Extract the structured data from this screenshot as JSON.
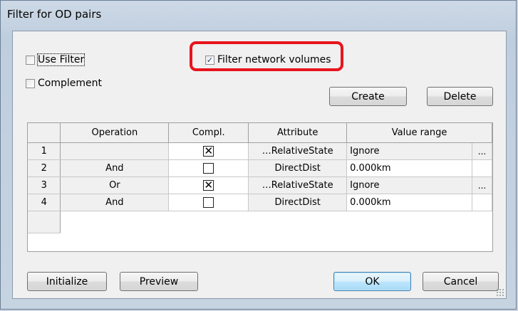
{
  "dialog": {
    "title": "Filter for OD pairs"
  },
  "options": {
    "use_filter": {
      "label": "Use Filter",
      "checked": false
    },
    "complement": {
      "label": "Complement",
      "checked": false
    },
    "filter_network_volumes": {
      "label": "Filter network volumes",
      "checked": true
    }
  },
  "buttons": {
    "create": "Create",
    "delete": "Delete",
    "initialize": "Initialize",
    "preview": "Preview",
    "ok": "OK",
    "cancel": "Cancel"
  },
  "table": {
    "headers": [
      "",
      "Operation",
      "Compl.",
      "Attribute",
      "Value range"
    ],
    "rows": [
      {
        "num": "1",
        "operation": "",
        "compl": true,
        "attribute": "…RelativeState",
        "value": "Ignore",
        "has_dots": true
      },
      {
        "num": "2",
        "operation": "And",
        "compl": false,
        "attribute": "DirectDist",
        "value": "0.000km",
        "has_dots": false
      },
      {
        "num": "3",
        "operation": "Or",
        "compl": true,
        "attribute": "…RelativeState",
        "value": "Ignore",
        "has_dots": true
      },
      {
        "num": "4",
        "operation": "And",
        "compl": false,
        "attribute": "DirectDist",
        "value": "0.000km",
        "has_dots": false
      }
    ],
    "dots_label": "..."
  },
  "colors": {
    "highlight": "#e8141d",
    "default_button_border": "#3c7fb1"
  }
}
